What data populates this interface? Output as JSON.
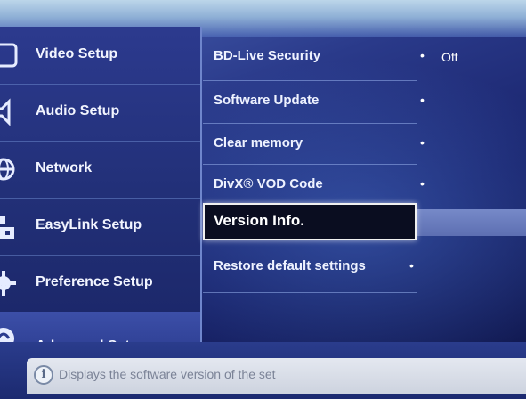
{
  "sidebar": {
    "items": [
      {
        "label": "Video Setup",
        "icon": "display-icon"
      },
      {
        "label": "Audio Setup",
        "icon": "speaker-icon"
      },
      {
        "label": "Network",
        "icon": "globe-icon"
      },
      {
        "label": "EasyLink Setup",
        "icon": "link-icon"
      },
      {
        "label": "Preference Setup",
        "icon": "gear-icon"
      },
      {
        "label": "Advanced Setup",
        "icon": "advanced-icon"
      }
    ],
    "active": "Advanced Setup"
  },
  "menu": {
    "items": [
      {
        "label": "BD-Live Security",
        "value": "Off"
      },
      {
        "label": "Software Update",
        "value": ""
      },
      {
        "label": "Clear memory",
        "value": ""
      },
      {
        "label": "DivX® VOD Code",
        "value": ""
      },
      {
        "label": "Version Info.",
        "value": ""
      },
      {
        "label": "Restore default settings",
        "value": ""
      }
    ],
    "selected": "Version Info.",
    "bullet": "•"
  },
  "info": {
    "text": "Displays the software version of the set",
    "icon_glyph": "i"
  },
  "colors": {
    "background": "#1a2566",
    "highlight_bg": "#0a0d20",
    "highlight_border": "#f0f0f0",
    "info_bar": "#dde2eb"
  }
}
